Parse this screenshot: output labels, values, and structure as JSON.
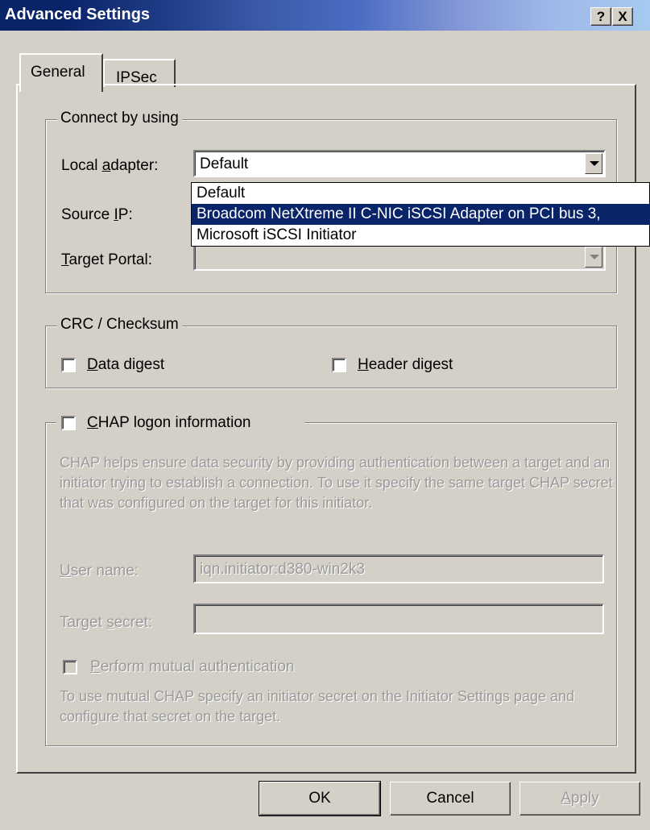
{
  "window": {
    "title": "Advanced Settings",
    "help_btn": "?",
    "close_btn": "X"
  },
  "tabs": [
    {
      "label": "General"
    },
    {
      "label": "IPSec"
    }
  ],
  "connect": {
    "legend": "Connect by using",
    "local_adapter_label": "Local adapter:",
    "local_adapter_value": "Default",
    "source_ip_label": "Source IP:",
    "target_portal_label": "Target Portal:"
  },
  "dropdown_options": [
    "Default",
    "Broadcom NetXtreme II C-NIC iSCSI Adapter on PCI bus 3,",
    "Microsoft iSCSI Initiator"
  ],
  "crc": {
    "legend": "CRC / Checksum",
    "data_digest": "Data digest",
    "header_digest": "Header digest"
  },
  "chap": {
    "legend": "CHAP logon information",
    "description": "CHAP helps ensure data security by providing authentication between a target and an initiator trying to establish a connection. To use it specify the same target CHAP secret that was configured on the target for this initiator.",
    "user_name_label": "User name:",
    "user_name_value": "iqn.initiator:d380-win2k3",
    "target_secret_label": "Target secret:",
    "target_secret_value": "",
    "mutual_auth_label": "Perform mutual authentication",
    "mutual_note": "To use mutual CHAP specify an initiator secret on the Initiator Settings page and configure that secret on the target."
  },
  "buttons": {
    "ok": "OK",
    "cancel": "Cancel",
    "apply": "Apply"
  }
}
